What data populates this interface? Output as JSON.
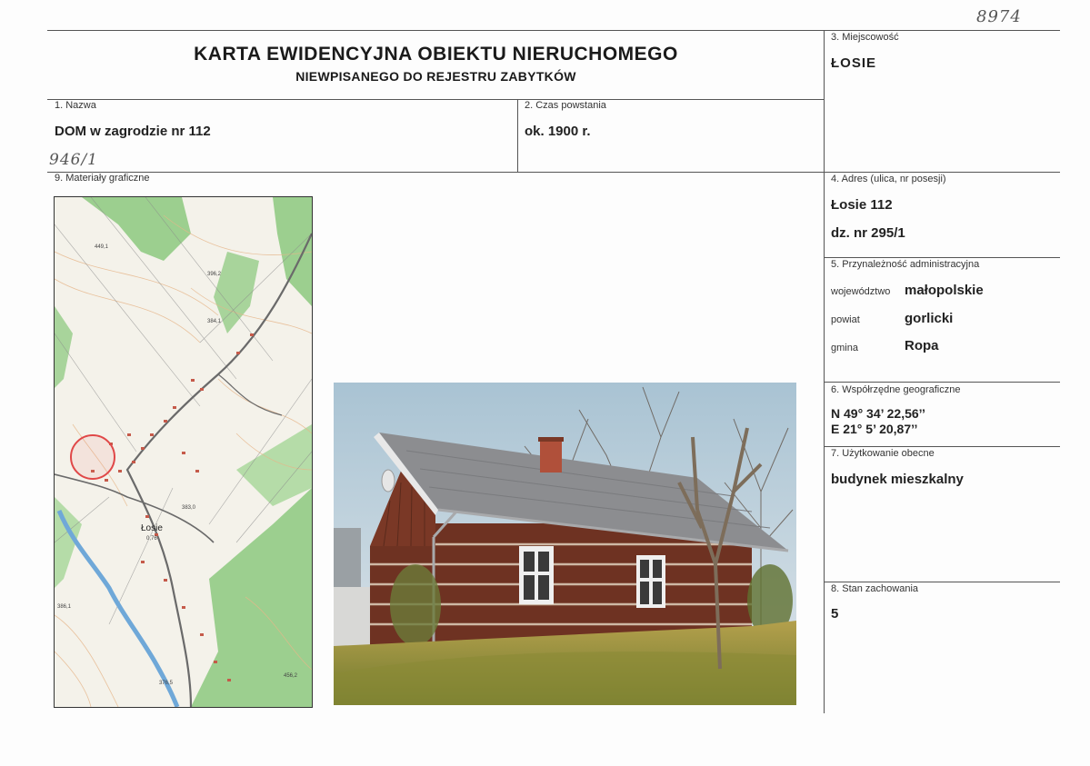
{
  "handwritten": {
    "inventory_number": "8974",
    "parcel_note": "946/1"
  },
  "title": {
    "line1": "KARTA EWIDENCYJNA OBIEKTU NIERUCHOMEGO",
    "line2": "NIEWPISANEGO DO REJESTRU ZABYTKÓW"
  },
  "field_3": {
    "label": "3. Miejscowość",
    "value": "ŁOSIE"
  },
  "field_1": {
    "label": "1. Nazwa",
    "value": "DOM w zagrodzie nr 112"
  },
  "field_2": {
    "label": "2. Czas powstania",
    "value": "ok. 1900 r."
  },
  "field_9": {
    "label": "9. Materiały graficzne"
  },
  "field_4": {
    "label": "4. Adres (ulica, nr posesji)",
    "address": "Łosie 112",
    "parcel": "dz. nr 295/1"
  },
  "field_5": {
    "label": "5. Przynależność administracyjna",
    "rows": [
      {
        "key": "województwo",
        "value": "małopolskie"
      },
      {
        "key": "powiat",
        "value": "gorlicki"
      },
      {
        "key": "gmina",
        "value": "Ropa"
      }
    ]
  },
  "field_6": {
    "label": "6. Współrzędne geograficzne",
    "lat": "N 49° 34’ 22,56’’",
    "lon": "E 21° 5’ 20,87’’"
  },
  "field_7": {
    "label": "7. Użytkowanie obecne",
    "value": "budynek mieszkalny"
  },
  "field_8": {
    "label": "8. Stan zachowania",
    "value": "5"
  },
  "map": {
    "place_label": "Łosie",
    "place_sub": "0,76",
    "spot_heights": [
      "449,1",
      "396,2",
      "384,1",
      "383,0",
      "386,1",
      "456,2",
      "376,5"
    ],
    "colors": {
      "forest": "#9ccf8f",
      "road": "#6a6a6a",
      "river": "#6fa8d8",
      "marker": "#e04848"
    }
  },
  "photo": {
    "colors": {
      "sky": "#c8d6df",
      "wall": "#6e3222",
      "roof": "#8c8d90",
      "grass": "#9f8d3c"
    }
  }
}
